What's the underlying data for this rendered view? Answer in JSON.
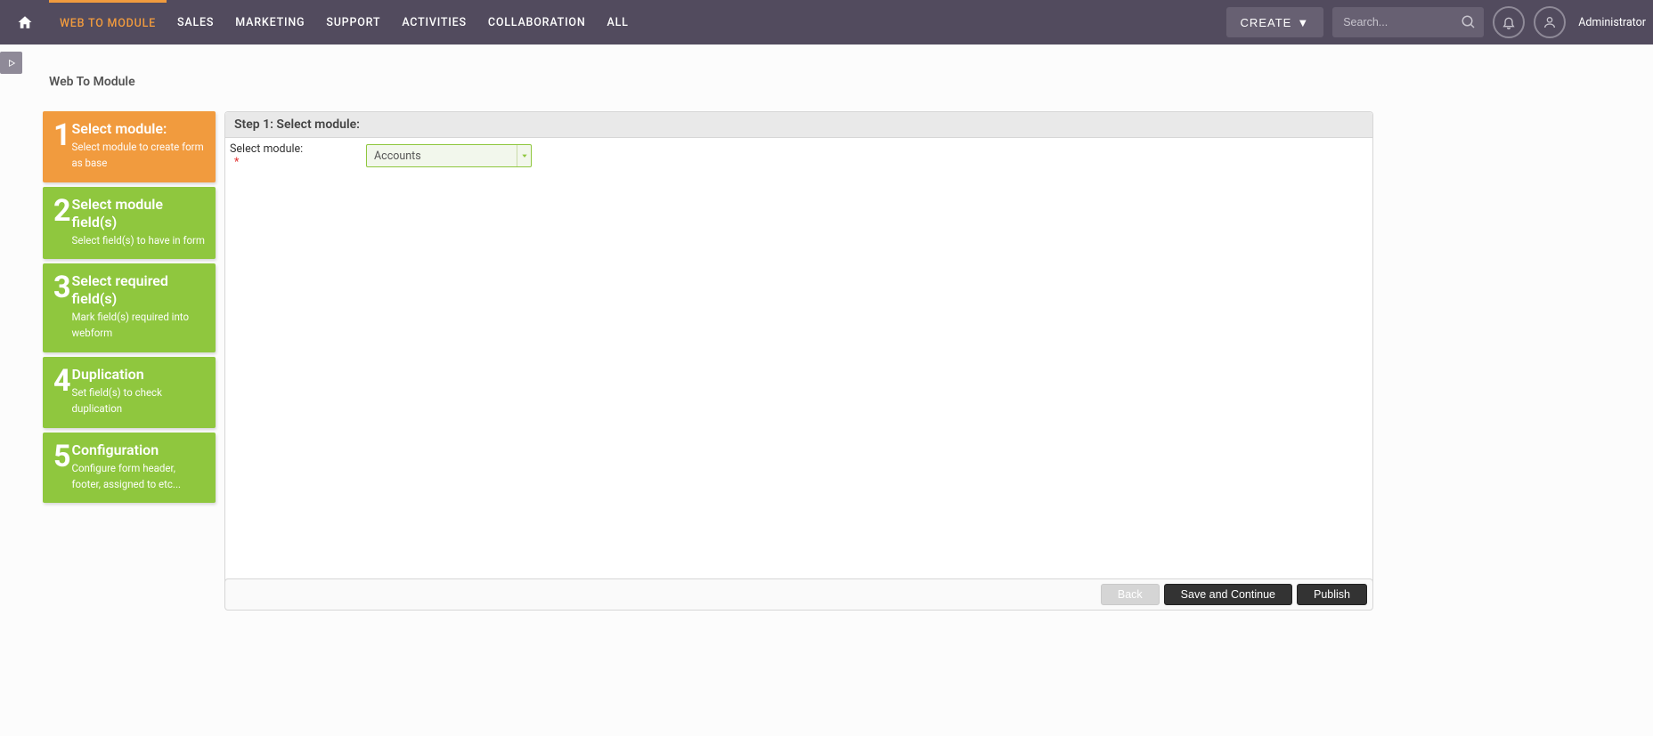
{
  "nav": {
    "items": [
      {
        "label": "WEB TO MODULE",
        "active": true
      },
      {
        "label": "SALES"
      },
      {
        "label": "MARKETING"
      },
      {
        "label": "SUPPORT"
      },
      {
        "label": "ACTIVITIES"
      },
      {
        "label": "COLLABORATION"
      },
      {
        "label": "ALL"
      }
    ],
    "create_label": "CREATE",
    "search_placeholder": "Search...",
    "user_label": "Administrator"
  },
  "page": {
    "title": "Web To Module"
  },
  "steps": [
    {
      "num": "1",
      "title": "Select module:",
      "desc": "Select module to create form as base",
      "active": true
    },
    {
      "num": "2",
      "title": "Select module field(s)",
      "desc": "Select field(s) to have in form"
    },
    {
      "num": "3",
      "title": "Select required field(s)",
      "desc": "Mark field(s) required into webform"
    },
    {
      "num": "4",
      "title": "Duplication",
      "desc": "Set field(s) to check duplication"
    },
    {
      "num": "5",
      "title": "Configuration",
      "desc": "Configure form header, footer, assigned to etc..."
    }
  ],
  "panel": {
    "header": "Step 1: Select module:",
    "field_label": "Select module:",
    "required_mark": "*",
    "selected_value": "Accounts"
  },
  "actions": {
    "back": "Back",
    "save": "Save and Continue",
    "publish": "Publish"
  },
  "colors": {
    "accent_orange": "#f19b3e",
    "accent_green": "#8fc73e",
    "nav_bg": "#524b5e"
  }
}
